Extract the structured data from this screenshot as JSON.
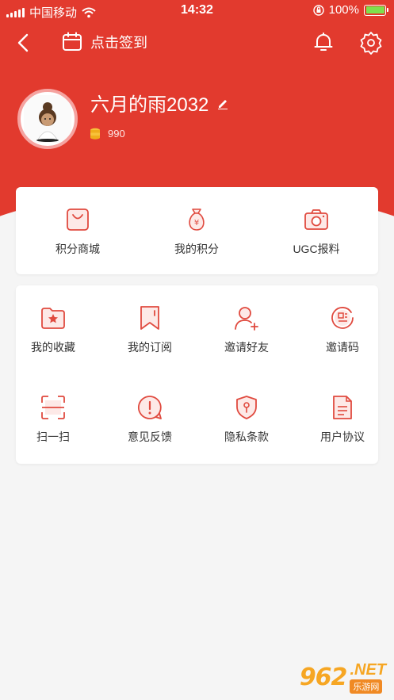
{
  "status_bar": {
    "carrier": "中国移动",
    "time": "14:32",
    "battery": "100%"
  },
  "nav": {
    "checkin_label": "点击签到"
  },
  "profile": {
    "username": "六月的雨2032",
    "coins": "990"
  },
  "quick_actions": [
    {
      "label": "积分商城",
      "icon": "shopping-bag-icon"
    },
    {
      "label": "我的积分",
      "icon": "money-bag-icon"
    },
    {
      "label": "UGC报料",
      "icon": "camera-icon"
    }
  ],
  "menu": [
    {
      "label": "我的收藏",
      "icon": "favorite-folder-icon"
    },
    {
      "label": "我的订阅",
      "icon": "bookmark-icon"
    },
    {
      "label": "邀请好友",
      "icon": "add-friend-icon"
    },
    {
      "label": "邀请码",
      "icon": "invite-code-icon"
    },
    {
      "label": "扫一扫",
      "icon": "scan-icon"
    },
    {
      "label": "意见反馈",
      "icon": "feedback-icon"
    },
    {
      "label": "隐私条款",
      "icon": "privacy-shield-icon"
    },
    {
      "label": "用户协议",
      "icon": "document-icon"
    }
  ],
  "watermark": {
    "number": "962",
    "suffix": ".NET",
    "sub": "乐游网"
  },
  "colors": {
    "brand_red": "#e23a2e",
    "icon_red": "#e04a3f",
    "battery_green": "#7ee04c"
  }
}
